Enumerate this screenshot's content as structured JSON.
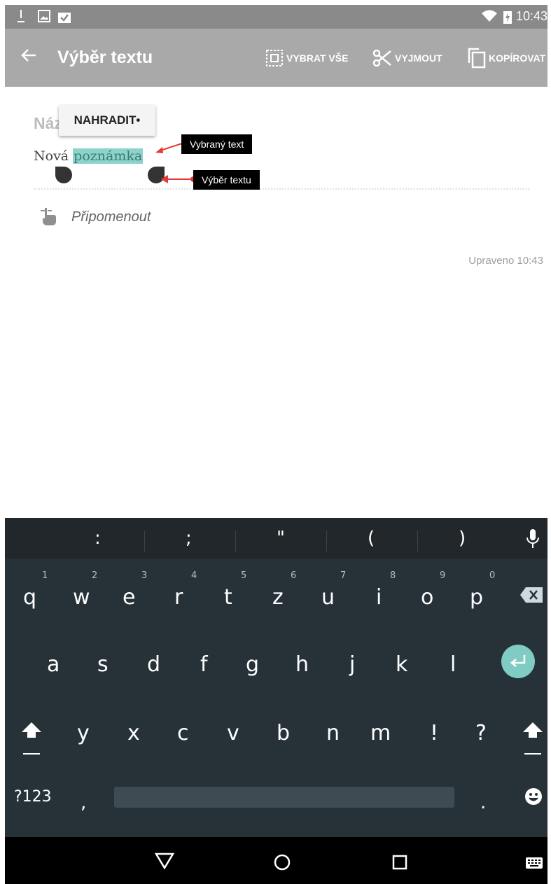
{
  "status_bar": {
    "time": "10:43",
    "left_icons": [
      "download-icon",
      "image-icon",
      "clipboard-check-icon"
    ],
    "right_icons": [
      "wifi-icon",
      "battery-charging-icon"
    ]
  },
  "action_bar": {
    "title": "Výběr textu",
    "actions": [
      {
        "label": "VYBRAT VŠE",
        "icon": "select-all-icon"
      },
      {
        "label": "VYJMOUT",
        "icon": "scissors-icon"
      },
      {
        "label": "KOPÍROVAT",
        "icon": "copy-icon"
      }
    ]
  },
  "note": {
    "title_partial": "Náz",
    "popup_label": "NAHRADIT•",
    "body_prefix": "Nová ",
    "body_selected": "poznámka",
    "reminder_label": "Připomenout",
    "edited": "Upraveno 10:43"
  },
  "callouts": {
    "selected_text": "Vybraný text",
    "text_selection": "Výběr textu"
  },
  "keyboard": {
    "suggestions": [
      ":",
      ";",
      "\"",
      "(",
      ")"
    ],
    "row1": [
      "q",
      "w",
      "e",
      "r",
      "t",
      "z",
      "u",
      "i",
      "o",
      "p"
    ],
    "row1_hints": [
      "1",
      "2",
      "3",
      "4",
      "5",
      "6",
      "7",
      "8",
      "9",
      "0"
    ],
    "row2": [
      "a",
      "s",
      "d",
      "f",
      "g",
      "h",
      "j",
      "k",
      "l"
    ],
    "row3": [
      "y",
      "x",
      "c",
      "v",
      "b",
      "n",
      "m",
      "!",
      "?"
    ],
    "symbols_key": "?123",
    "comma_key": ",",
    "period_key": ".",
    "accent_color": "#80cbc4"
  },
  "colors": {
    "status_bar": "#8a8a8a",
    "action_bar": "#a9a9a9",
    "selection": "#8dd3cc",
    "keyboard_bg": "#263238"
  }
}
